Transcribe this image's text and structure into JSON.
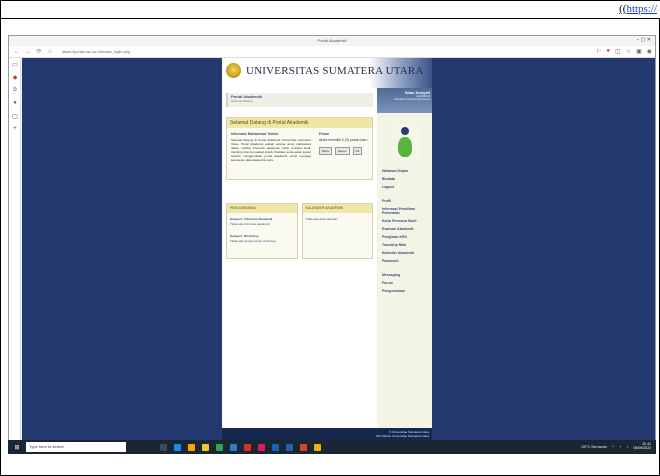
{
  "header": {
    "link_prefix": "((",
    "link_text": "https://"
  },
  "window": {
    "title": "Portal Akademik",
    "controls": "−  ▢  ✕"
  },
  "toolbar": {
    "address": "https://portal.usu.ac.id/index_login.php"
  },
  "site": {
    "university_name": "UNIVERSITAS SUMATERA UTARA",
    "portal_title": "Portal Akademik",
    "portal_subtitle": "Selamat Datang",
    "welcome_title": "Selamat Datang di Portal Akademik",
    "info": {
      "title": "Informasi Mahasiswa Terkini",
      "text": "Selamat Datang di Portal Akademik Universitas Sumatera Utara. Portal akademik adalah sarana untuk mahasiswa dalam melihat informasi akademik, kartu rencana studi, transkrip nilai dan jadwal kuliah. Pastikan anda selalu logout setelah menggunakan portal akademik untuk menjaga keamanan data akademik anda."
    },
    "password_notice": {
      "title": "Pesan",
      "text": "Anda memiliki 0 (0) pesan baru",
      "buttons": [
        "Baca",
        "Hapus",
        "Ok"
      ]
    },
    "sections": {
      "left_head": "PENGUMUMAN",
      "left_items": [
        {
          "title": "Kategori: Informasi Akademik",
          "link": "Tidak ada informasi akademik"
        },
        {
          "title": "Kategori: Workshop",
          "link": "Tidak ada pengumuman workshop"
        }
      ],
      "right_head": "KALENDER AKADEMIK",
      "right_items": [
        {
          "link": "Tidak ada data kalender"
        }
      ]
    },
    "user": {
      "name": "Intan Sunyeti",
      "id": "2202030110",
      "faculty": "Fakultas Kesehatan Masyarakat"
    },
    "menu_top": [
      "Halaman Depan",
      "Biodata",
      "Logout"
    ],
    "menu_academic": [
      "Profil",
      "Informasi Pemilihan Peminatan",
      "Kartu Rencana Studi",
      "Evaluasi Akademik",
      "Pengisian KRS",
      "Transkrip Nilai",
      "Kalender Akademik",
      "Password"
    ],
    "menu_misc": [
      "Messaging",
      "Forum",
      "Pengumuman"
    ],
    "footer": {
      "line1": "© Universitas Sumatera Utara",
      "line2": "Biro Rektor Universitas Sumatera Utara"
    }
  },
  "taskbar": {
    "search_placeholder": "Type here to search",
    "apps": [
      {
        "name": "task-view",
        "color": "#3a4a5e"
      },
      {
        "name": "edge",
        "color": "#1e88e5"
      },
      {
        "name": "store",
        "color": "#f2a900"
      },
      {
        "name": "explorer",
        "color": "#f4c430"
      },
      {
        "name": "chrome",
        "color": "#2ea84a"
      },
      {
        "name": "vscode",
        "color": "#2b7cd3"
      },
      {
        "name": "acrobat",
        "color": "#d93025"
      },
      {
        "name": "opera",
        "color": "#d81b60"
      },
      {
        "name": "mail",
        "color": "#1565c0"
      },
      {
        "name": "word",
        "color": "#2a5db0"
      },
      {
        "name": "powerpoint",
        "color": "#d24726"
      },
      {
        "name": "chrome2",
        "color": "#f0b400"
      }
    ],
    "weather": "28°C Berawan",
    "time": "20.41",
    "date": "05/09/2022"
  }
}
